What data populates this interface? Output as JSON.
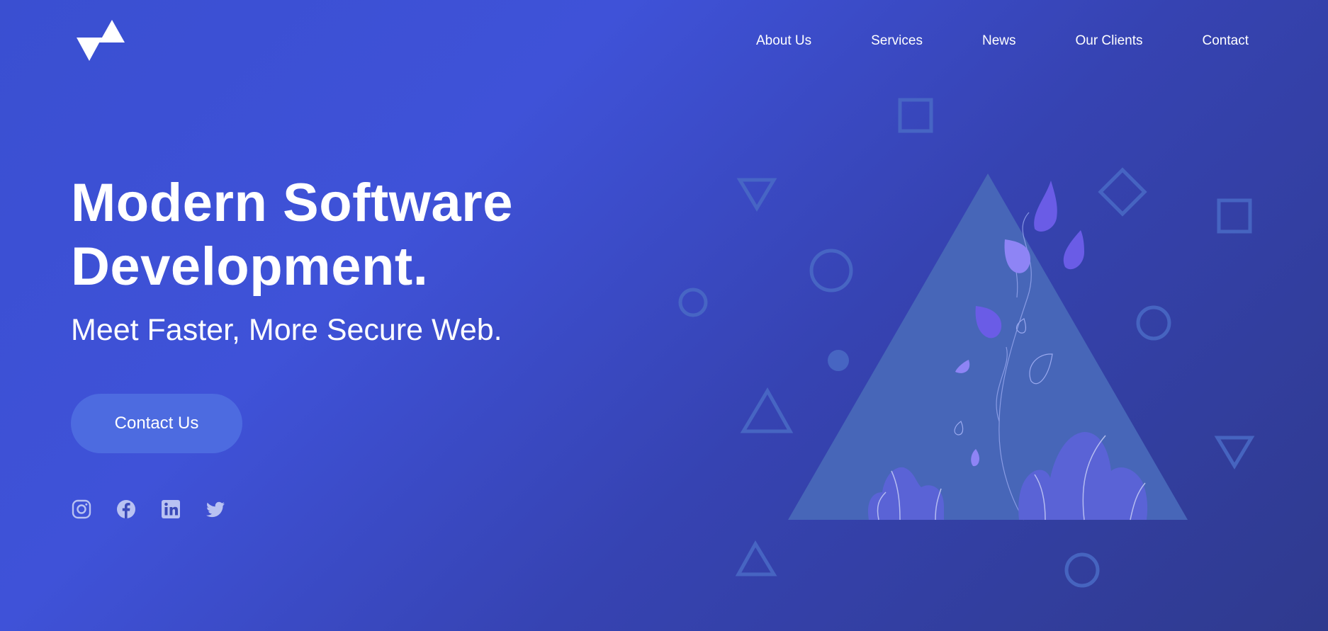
{
  "brand": {
    "logo_icon": "zigzag-triangles-logo"
  },
  "nav": {
    "items": [
      {
        "label": "About Us"
      },
      {
        "label": "Services"
      },
      {
        "label": "News"
      },
      {
        "label": "Our Clients"
      },
      {
        "label": "Contact"
      }
    ]
  },
  "hero": {
    "title_line1": "Modern Software",
    "title_line2": "Development.",
    "subtitle": "Meet Faster, More Secure Web.",
    "cta_label": "Contact Us"
  },
  "socials": [
    {
      "icon": "instagram-icon"
    },
    {
      "icon": "facebook-icon"
    },
    {
      "icon": "linkedin-icon"
    },
    {
      "icon": "twitter-icon"
    }
  ],
  "colors": {
    "background_start": "#3f52d8",
    "background_end": "#2f3a8e",
    "cta_background": "#4d6be0",
    "illustration_triangle": "#4766b8",
    "leaf_purple": "#6a5ce6",
    "leaf_light": "#8e84f5"
  }
}
